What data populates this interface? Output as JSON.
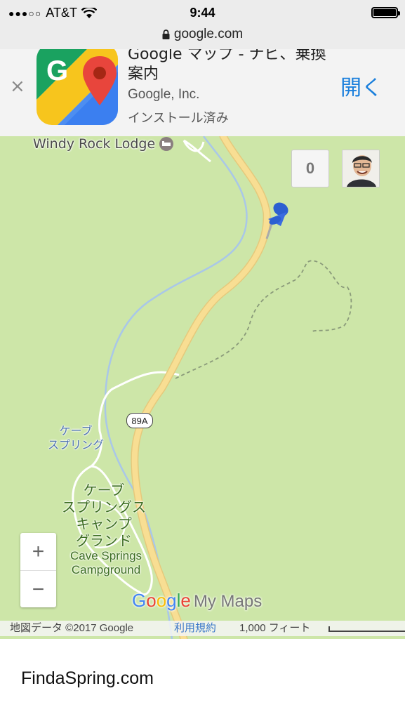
{
  "status_bar": {
    "signal_dots": "●●●○○",
    "carrier": "AT&T",
    "time": "9:44",
    "battery_level": 1.0
  },
  "url_bar": {
    "domain": "google.com"
  },
  "app_banner": {
    "close_label": "×",
    "title": "Google マップ - ナビ、乗換案内",
    "publisher": "Google, Inc.",
    "install_status": "インストール済み",
    "open_label": "開く"
  },
  "map": {
    "lodge_label": "Windy Rock Lodge",
    "cave_label_line1": "ケーブ",
    "cave_label_line2": "スプリング",
    "camp_jp_line1": "ケーブ",
    "camp_jp_line2": "スプリングス",
    "camp_jp_line3": "キャンプ",
    "camp_jp_line4": "グランド",
    "camp_en_line1": "Cave Springs",
    "camp_en_line2": "Campground",
    "route_shield": "89A",
    "counter_value": "0",
    "zoom_in": "+",
    "zoom_out": "−",
    "logo": {
      "g1": "G",
      "g2": "o",
      "g3": "o",
      "g4": "g",
      "g5": "l",
      "g6": "e",
      "suffix": "My Maps"
    },
    "attribution": {
      "data": "地図データ ©2017 Google",
      "terms": "利用規約",
      "scale": "1,000 フィート"
    },
    "colors": {
      "land": "#cde6a8",
      "road": "#f6d98c",
      "river": "#a9c7e8",
      "trail": "#8a9a7a"
    }
  },
  "footer": {
    "site": "FindaSpring.com"
  }
}
